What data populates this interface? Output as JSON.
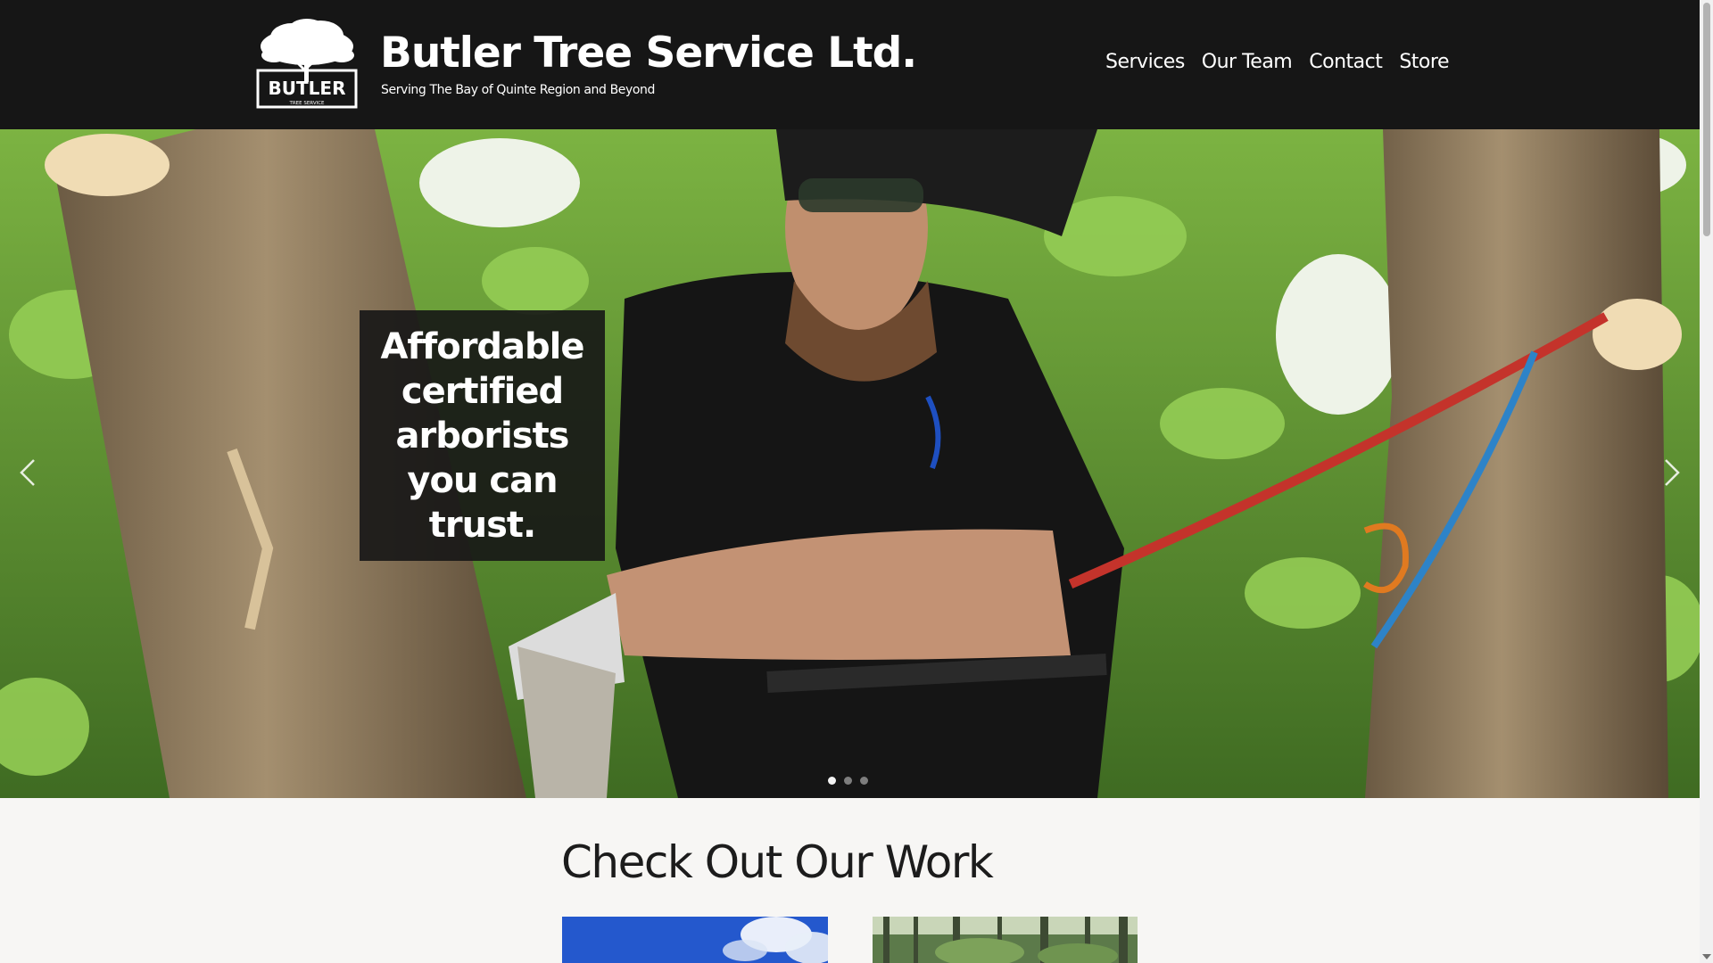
{
  "site": {
    "logo_word": "BUTLER",
    "logo_sub": "TREE SERVICE",
    "title": "Butler Tree Service Ltd.",
    "tagline": "Serving The Bay of Quinte Region and Beyond"
  },
  "nav": {
    "items": [
      {
        "label": "Services"
      },
      {
        "label": "Our Team"
      },
      {
        "label": "Contact"
      },
      {
        "label": "Store"
      }
    ]
  },
  "hero": {
    "caption": "Affordable certified arborists you can trust.",
    "slide_count": 3,
    "active_slide": 1
  },
  "work": {
    "title": "Check Out Our Work"
  },
  "colors": {
    "header_bg": "#161616",
    "page_bg": "#f7f6f4",
    "accent_text": "#ffffff"
  }
}
